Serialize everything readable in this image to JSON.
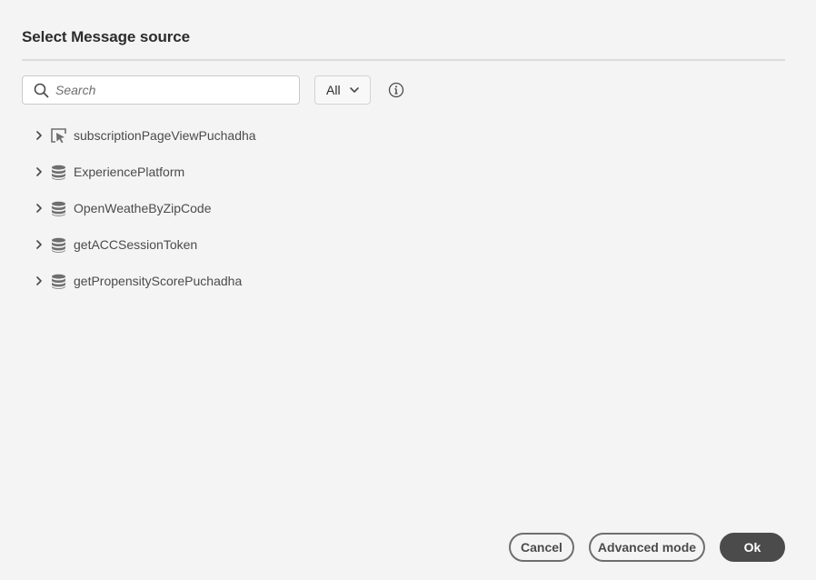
{
  "dialog": {
    "title": "Select Message source"
  },
  "search": {
    "placeholder": "Search",
    "value": "",
    "icon": "search-icon"
  },
  "filter": {
    "selected": "All",
    "icon": "chevron-down-icon"
  },
  "info": {
    "icon": "info-icon"
  },
  "tree": {
    "items": [
      {
        "label": "subscriptionPageViewPuchadha",
        "icon": "event-icon",
        "expand_icon": "chevron-right-icon"
      },
      {
        "label": "ExperiencePlatform",
        "icon": "database-icon",
        "expand_icon": "chevron-right-icon"
      },
      {
        "label": "OpenWeatheByZipCode",
        "icon": "database-icon",
        "expand_icon": "chevron-right-icon"
      },
      {
        "label": "getACCSessionToken",
        "icon": "database-icon",
        "expand_icon": "chevron-right-icon"
      },
      {
        "label": "getPropensityScorePuchadha",
        "icon": "database-icon",
        "expand_icon": "chevron-right-icon"
      }
    ]
  },
  "footer": {
    "cancel_label": "Cancel",
    "advanced_label": "Advanced mode",
    "ok_label": "Ok"
  },
  "colors": {
    "background": "#f4f4f4",
    "primary_button": "#4b4b4b",
    "icon_gray": "#6e6e6e"
  }
}
